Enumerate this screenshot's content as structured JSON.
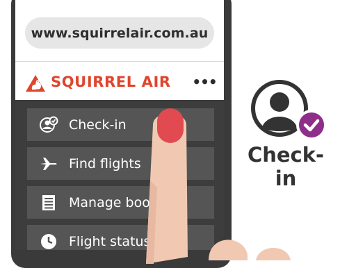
{
  "browser": {
    "url": "www.squirrelair.com.au"
  },
  "header": {
    "brand_name": "SQUIRREL AIR",
    "more_label": "•••"
  },
  "menu": {
    "items": [
      {
        "label": "Check-in",
        "icon": "user-check-icon"
      },
      {
        "label": "Find flights",
        "icon": "airplane-icon"
      },
      {
        "label": "Manage boo",
        "icon": "document-icon"
      },
      {
        "label": "Flight status",
        "icon": "clock-icon"
      }
    ]
  },
  "callout": {
    "label": "Check-in",
    "icon": "user-check-icon"
  },
  "colors": {
    "brand": "#e0452c",
    "menu_bg": "#3d3d3d",
    "menu_item_bg": "#555555",
    "check_badge": "#8e2d8a",
    "fingernail": "#e04a50",
    "skin": "#f1c9b3"
  }
}
